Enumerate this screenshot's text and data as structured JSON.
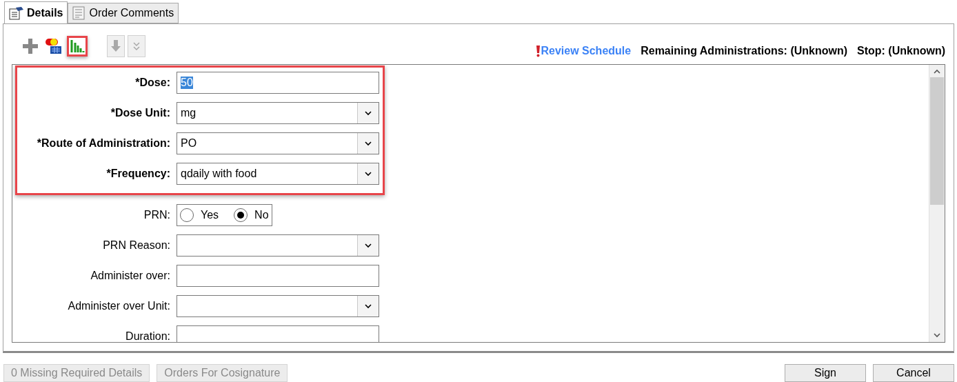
{
  "tabs": [
    {
      "label": "Details",
      "selected": true
    },
    {
      "label": "Order Comments",
      "selected": false
    }
  ],
  "toolbar": {
    "tools": [
      {
        "kind": "add",
        "disabled": false,
        "highlighted": false
      },
      {
        "kind": "medication",
        "disabled": false,
        "highlighted": false
      },
      {
        "kind": "chart",
        "disabled": false,
        "highlighted": true
      },
      {
        "kind": "down",
        "disabled": true,
        "highlighted": false
      },
      {
        "kind": "expand",
        "disabled": true,
        "highlighted": false
      }
    ]
  },
  "schedule": {
    "link": "Review Schedule",
    "remaining": "Remaining Administrations: (Unknown)",
    "stop": "Stop: (Unknown)"
  },
  "field_groups": [
    {
      "highlighted": true,
      "fields": [
        {
          "kind": "text",
          "label": "*Dose:",
          "required": true,
          "value": "50",
          "value_selected": true
        },
        {
          "kind": "dropdown",
          "label": "*Dose Unit:",
          "required": true,
          "value": "mg"
        },
        {
          "kind": "dropdown",
          "label": "*Route of Administration:",
          "required": true,
          "value": "PO"
        },
        {
          "kind": "dropdown",
          "label": "*Frequency:",
          "required": true,
          "value": "qdaily with food"
        }
      ]
    },
    {
      "highlighted": false,
      "fields": [
        {
          "kind": "radio",
          "label": "PRN:",
          "required": false,
          "options": [
            {
              "label": "Yes",
              "selected": false
            },
            {
              "label": "No",
              "selected": true
            }
          ]
        },
        {
          "kind": "dropdown",
          "label": "PRN Reason:",
          "required": false
        },
        {
          "kind": "text",
          "label": "Administer over:",
          "required": false
        },
        {
          "kind": "dropdown",
          "label": "Administer over Unit:",
          "required": false
        },
        {
          "kind": "text",
          "label": "Duration:",
          "required": false
        }
      ]
    }
  ],
  "footer": {
    "left_buttons": [
      {
        "label": "0 Missing Required Details",
        "disabled": true
      },
      {
        "label": "Orders For Cosignature",
        "disabled": true
      }
    ],
    "right_buttons": [
      {
        "label": "Sign",
        "disabled": false
      },
      {
        "label": "Cancel",
        "disabled": false
      }
    ]
  }
}
